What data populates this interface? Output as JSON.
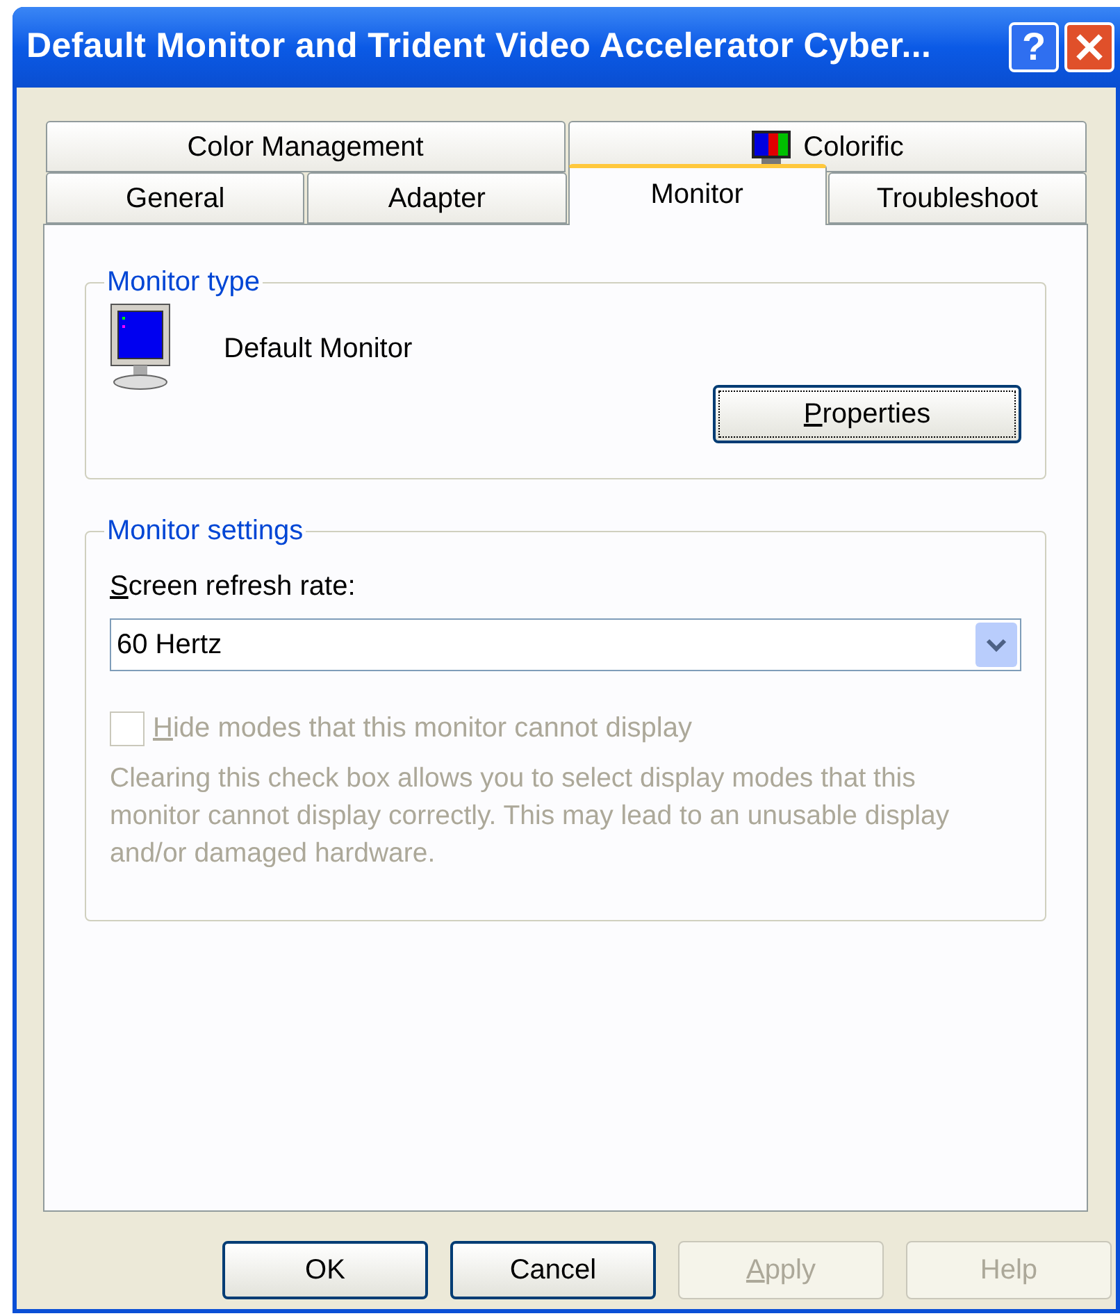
{
  "window": {
    "title": "Default Monitor and Trident Video Accelerator Cyber...",
    "help_glyph": "?"
  },
  "tab_rows": [
    [
      {
        "label": "Color Management",
        "selected": false,
        "has_icon": false
      },
      {
        "label": "Colorific",
        "selected": false,
        "has_icon": true
      }
    ],
    [
      {
        "label": "General",
        "selected": false,
        "has_icon": false
      },
      {
        "label": "Adapter",
        "selected": false,
        "has_icon": false
      },
      {
        "label": "Monitor",
        "selected": true,
        "has_icon": false
      },
      {
        "label": "Troubleshoot",
        "selected": false,
        "has_icon": false
      }
    ]
  ],
  "monitor_type": {
    "legend": "Monitor type",
    "monitor_name": "Default Monitor",
    "button": {
      "label": "Properties",
      "mnemonic": true,
      "focused": true
    }
  },
  "monitor_settings": {
    "legend": "Monitor settings",
    "refresh_label": {
      "text": "Screen refresh rate:",
      "mnemonic": true
    },
    "refresh_rate": "60 Hertz",
    "checkbox": {
      "label": "Hide modes that this monitor cannot display",
      "mnemonic": true,
      "checked": false,
      "disabled": true
    },
    "note": {
      "text": "Clearing this check box allows you to select display modes that this monitor cannot display correctly. This may lead to an unusable display and/or damaged hardware.",
      "disabled": true
    }
  },
  "buttons": [
    {
      "label": "OK",
      "mnemonic": false,
      "disabled": false
    },
    {
      "label": "Cancel",
      "mnemonic": false,
      "disabled": false
    },
    {
      "label": "Apply",
      "mnemonic": true,
      "disabled": true
    },
    {
      "label": "Help",
      "mnemonic": false,
      "disabled": true
    }
  ]
}
